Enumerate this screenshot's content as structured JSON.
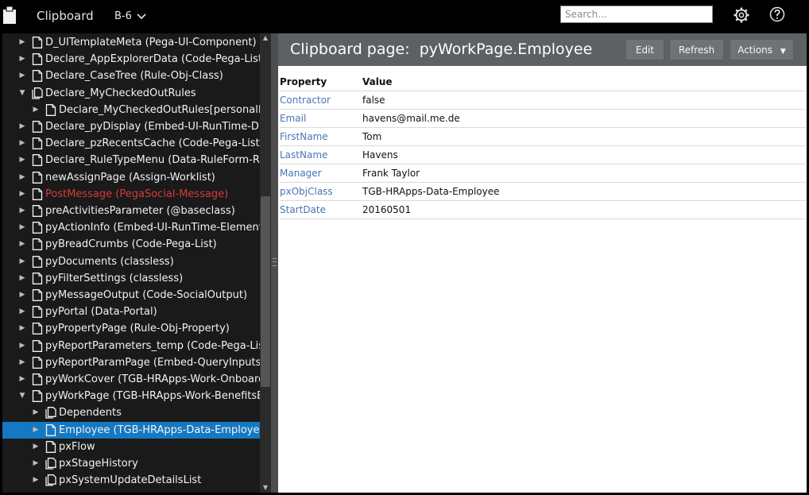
{
  "app": {
    "title": "Clipboard",
    "node": "B-6"
  },
  "search": {
    "placeholder": "Search..."
  },
  "tree": [
    {
      "label": "D_UITemplateMeta (Pega-UI-Component)",
      "indent": 0,
      "expanded": false,
      "icon": "page"
    },
    {
      "label": "Declare_AppExplorerData (Code-Pega-List)",
      "indent": 0,
      "expanded": false,
      "icon": "page"
    },
    {
      "label": "Declare_CaseTree (Rule-Obj-Class)",
      "indent": 0,
      "expanded": false,
      "icon": "page"
    },
    {
      "label": "Declare_MyCheckedOutRules",
      "indent": 0,
      "expanded": true,
      "icon": "pagelist"
    },
    {
      "label": "Declare_MyCheckedOutRules[personalRules]",
      "indent": 1,
      "expanded": false,
      "icon": "page"
    },
    {
      "label": "Declare_pyDisplay (Embed-UI-RunTime-Display)",
      "indent": 0,
      "expanded": false,
      "icon": "page"
    },
    {
      "label": "Declare_pzRecentsCache (Code-Pega-List)",
      "indent": 0,
      "expanded": false,
      "icon": "page"
    },
    {
      "label": "Declare_RuleTypeMenu (Data-RuleForm-Rule)",
      "indent": 0,
      "expanded": false,
      "icon": "page"
    },
    {
      "label": "newAssignPage (Assign-Worklist)",
      "indent": 0,
      "expanded": false,
      "icon": "page"
    },
    {
      "label": "PostMessage (PegaSocial-Message)",
      "indent": 0,
      "expanded": false,
      "icon": "page",
      "error": true
    },
    {
      "label": "preActivitiesParameter (@baseclass)",
      "indent": 0,
      "expanded": false,
      "icon": "page"
    },
    {
      "label": "pyActionInfo (Embed-UI-RunTime-Element)",
      "indent": 0,
      "expanded": false,
      "icon": "page"
    },
    {
      "label": "pyBreadCrumbs (Code-Pega-List)",
      "indent": 0,
      "expanded": false,
      "icon": "page"
    },
    {
      "label": "pyDocuments (classless)",
      "indent": 0,
      "expanded": false,
      "icon": "page"
    },
    {
      "label": "pyFilterSettings (classless)",
      "indent": 0,
      "expanded": false,
      "icon": "page"
    },
    {
      "label": "pyMessageOutput (Code-SocialOutput)",
      "indent": 0,
      "expanded": false,
      "icon": "page"
    },
    {
      "label": "pyPortal (Data-Portal)",
      "indent": 0,
      "expanded": false,
      "icon": "page"
    },
    {
      "label": "pyPropertyPage (Rule-Obj-Property)",
      "indent": 0,
      "expanded": false,
      "icon": "page"
    },
    {
      "label": "pyReportParameters_temp (Code-Pega-List)",
      "indent": 0,
      "expanded": false,
      "icon": "page"
    },
    {
      "label": "pyReportParamPage (Embed-QueryInputs)",
      "indent": 0,
      "expanded": false,
      "icon": "page"
    },
    {
      "label": "pyWorkCover (TGB-HRApps-Work-Onboarding)",
      "indent": 0,
      "expanded": false,
      "icon": "page"
    },
    {
      "label": "pyWorkPage (TGB-HRApps-Work-BenefitsEnrollment)",
      "indent": 0,
      "expanded": true,
      "icon": "page"
    },
    {
      "label": "Dependents",
      "indent": 1,
      "expanded": false,
      "icon": "pagelist"
    },
    {
      "label": "Employee (TGB-HRApps-Data-Employee)",
      "indent": 1,
      "expanded": false,
      "icon": "page",
      "selected": true
    },
    {
      "label": "pxFlow",
      "indent": 1,
      "expanded": false,
      "icon": "page"
    },
    {
      "label": "pxStageHistory",
      "indent": 1,
      "expanded": false,
      "icon": "pagelist"
    },
    {
      "label": "pxSystemUpdateDetailsList",
      "indent": 1,
      "expanded": false,
      "icon": "pagelist"
    }
  ],
  "content": {
    "title_prefix": "Clipboard page:",
    "title_page": "pyWorkPage.Employee",
    "buttons": {
      "edit": "Edit",
      "refresh": "Refresh",
      "actions": "Actions"
    },
    "columns": {
      "property": "Property",
      "value": "Value"
    },
    "properties": [
      {
        "name": "Contractor",
        "value": "false"
      },
      {
        "name": "Email",
        "value": "havens@mail.me.de"
      },
      {
        "name": "FirstName",
        "value": "Tom"
      },
      {
        "name": "LastName",
        "value": "Havens"
      },
      {
        "name": "Manager",
        "value": "Frank Taylor"
      },
      {
        "name": "pxObjClass",
        "value": "TGB-HRApps-Data-Employee"
      },
      {
        "name": "StartDate",
        "value": "20160501"
      }
    ]
  },
  "colors": {
    "selected": "#1578c2",
    "error_text": "#d63a3a",
    "link_text": "#4b73b5",
    "header_bg": "#5e6163"
  }
}
